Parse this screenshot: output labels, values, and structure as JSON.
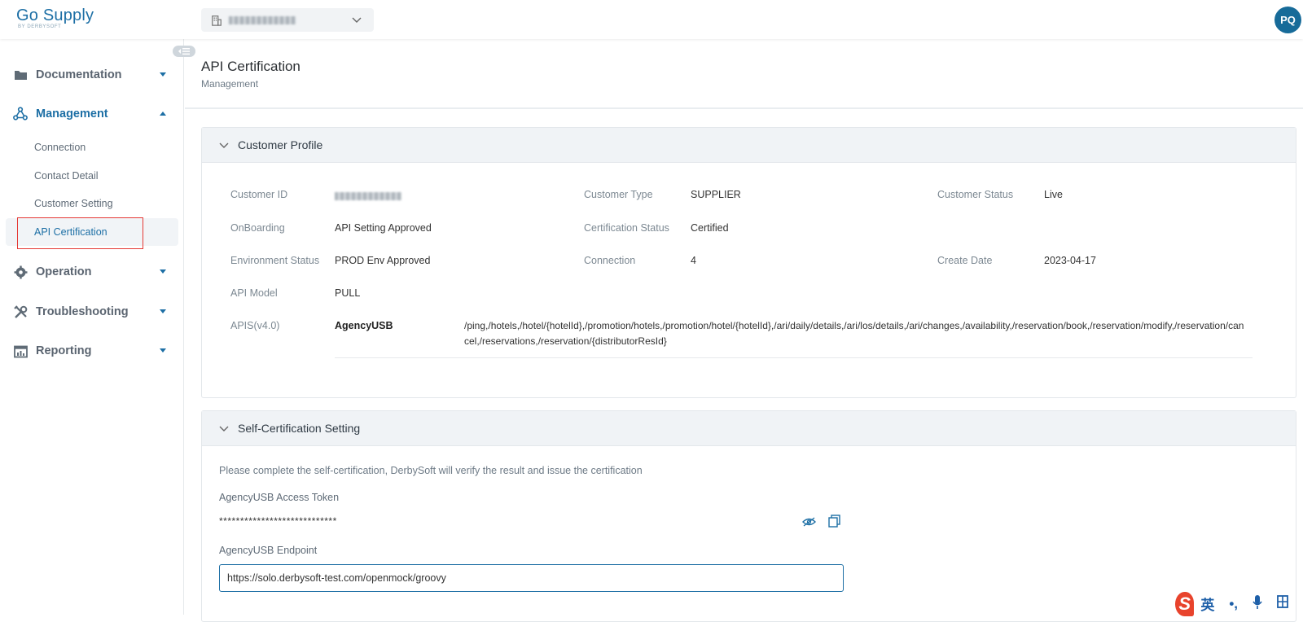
{
  "app": {
    "logo_main": "Go Supply",
    "logo_sub": "BY DERBYSOFT",
    "brand_color": "#1d6fa5"
  },
  "header": {
    "org_select_value": "",
    "avatar_initials": "PQ"
  },
  "sidebar": {
    "items": [
      {
        "label": "Documentation",
        "icon": "folder-icon",
        "expanded": false
      },
      {
        "label": "Management",
        "icon": "network-icon",
        "expanded": true
      },
      {
        "label": "Operation",
        "icon": "gear-icon",
        "expanded": false
      },
      {
        "label": "Troubleshooting",
        "icon": "tools-icon",
        "expanded": false
      },
      {
        "label": "Reporting",
        "icon": "calendar-chart-icon",
        "expanded": false
      }
    ],
    "management_sub": [
      "Connection",
      "Contact Detail",
      "Customer Setting",
      "API Certification"
    ],
    "active_sub": "API Certification"
  },
  "page": {
    "title": "API Certification",
    "subtitle": "Management"
  },
  "customer_profile": {
    "section_title": "Customer Profile",
    "labels": {
      "customer_id": "Customer ID",
      "customer_type": "Customer Type",
      "customer_status": "Customer Status",
      "onboarding": "OnBoarding",
      "certification_status": "Certification Status",
      "environment_status": "Environment Status",
      "connection": "Connection",
      "create_date": "Create Date",
      "api_model": "API Model",
      "apis": "APIS(v4.0)"
    },
    "values": {
      "customer_type": "SUPPLIER",
      "customer_status": "Live",
      "onboarding": "API Setting Approved",
      "certification_status": "Certified",
      "environment_status": "PROD Env Approved",
      "connection": "4",
      "create_date": "2023-04-17",
      "api_model": "PULL"
    },
    "api_name": "AgencyUSB",
    "api_paths": "/ping,/hotels,/hotel/{hotelId},/promotion/hotels,/promotion/hotel/{hotelId},/ari/daily/details,/ari/los/details,/ari/changes,/availability,/reservation/book,/reservation/modify,/reservation/cancel,/reservations,/reservation/{distributorResId}"
  },
  "self_cert": {
    "section_title": "Self-Certification Setting",
    "description": "Please complete the self-certification, DerbySoft will verify the result and issue the certification",
    "token_label": "AgencyUSB Access Token",
    "token_value": "****************************",
    "endpoint_label": "AgencyUSB Endpoint",
    "endpoint_value": "https://solo.derbysoft-test.com/openmock/groovy"
  },
  "ime": {
    "lang": "英",
    "punct": "•,",
    "mic": "mic-icon",
    "grid": "grid-icon"
  }
}
